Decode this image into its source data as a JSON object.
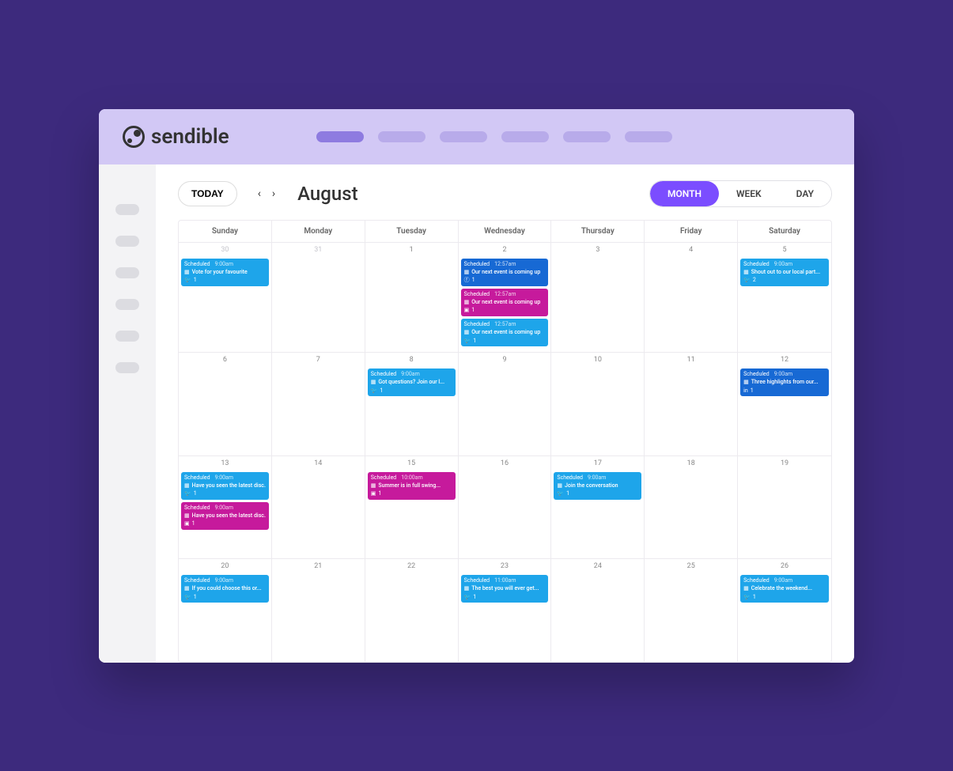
{
  "brand": "sendible",
  "toolbar": {
    "today": "TODAY",
    "month_title": "August",
    "views": {
      "month": "MONTH",
      "week": "WEEK",
      "day": "DAY"
    }
  },
  "dow": [
    "Sunday",
    "Monday",
    "Tuesday",
    "Wednesday",
    "Thursday",
    "Friday",
    "Saturday"
  ],
  "weeks": [
    [
      {
        "num": "30",
        "muted": true,
        "events": [
          {
            "color": "blue",
            "status": "Scheduled",
            "time": "9:00am",
            "title": "Vote for your favourite",
            "service": "twitter",
            "count": "1"
          }
        ]
      },
      {
        "num": "31",
        "muted": true,
        "events": []
      },
      {
        "num": "1",
        "events": []
      },
      {
        "num": "2",
        "events": [
          {
            "color": "dblue",
            "status": "Scheduled",
            "time": "12:57am",
            "title": "Our next event is coming up",
            "service": "facebook",
            "count": "1"
          },
          {
            "color": "pink",
            "status": "Scheduled",
            "time": "12:57am",
            "title": "Our next event is coming up",
            "service": "instagram",
            "count": "1"
          },
          {
            "color": "blue",
            "status": "Scheduled",
            "time": "12:57am",
            "title": "Our next event is coming up",
            "service": "twitter",
            "count": "1"
          }
        ]
      },
      {
        "num": "3",
        "events": []
      },
      {
        "num": "4",
        "events": []
      },
      {
        "num": "5",
        "events": [
          {
            "color": "blue",
            "status": "Scheduled",
            "time": "9:00am",
            "title": "Shout out to our local part...",
            "service": "twitter",
            "count": "2"
          }
        ]
      }
    ],
    [
      {
        "num": "6",
        "events": []
      },
      {
        "num": "7",
        "events": []
      },
      {
        "num": "8",
        "events": [
          {
            "color": "blue",
            "status": "Scheduled",
            "time": "9:00am",
            "title": "Got questions? Join our l...",
            "service": "twitter",
            "count": "1"
          }
        ]
      },
      {
        "num": "9",
        "events": []
      },
      {
        "num": "10",
        "events": []
      },
      {
        "num": "11",
        "events": []
      },
      {
        "num": "12",
        "events": [
          {
            "color": "dblue",
            "status": "Scheduled",
            "time": "9:00am",
            "title": "Three highlights from our...",
            "service": "linkedin",
            "count": "1"
          }
        ]
      }
    ],
    [
      {
        "num": "13",
        "events": [
          {
            "color": "blue",
            "status": "Scheduled",
            "time": "9:00am",
            "title": "Have you seen the latest disc...",
            "service": "twitter",
            "count": "1"
          },
          {
            "color": "pink",
            "status": "Scheduled",
            "time": "9:00am",
            "title": "Have you seen the latest disc...",
            "service": "instagram",
            "count": "1"
          }
        ]
      },
      {
        "num": "14",
        "events": []
      },
      {
        "num": "15",
        "events": [
          {
            "color": "pink",
            "status": "Scheduled",
            "time": "10:00am",
            "title": "Summer is in full swing...",
            "service": "instagram",
            "count": "1"
          }
        ]
      },
      {
        "num": "16",
        "events": []
      },
      {
        "num": "17",
        "events": [
          {
            "color": "blue",
            "status": "Scheduled",
            "time": "9:00am",
            "title": "Join the conversation",
            "service": "twitter",
            "count": "1"
          }
        ]
      },
      {
        "num": "18",
        "events": []
      },
      {
        "num": "19",
        "events": []
      }
    ],
    [
      {
        "num": "20",
        "events": [
          {
            "color": "blue",
            "status": "Scheduled",
            "time": "9:00am",
            "title": "If you could choose this or...",
            "service": "twitter",
            "count": "1"
          }
        ]
      },
      {
        "num": "21",
        "events": []
      },
      {
        "num": "22",
        "events": []
      },
      {
        "num": "23",
        "events": [
          {
            "color": "blue",
            "status": "Scheduled",
            "time": "11:00am",
            "title": "The best you will ever get...",
            "service": "twitter",
            "count": "1"
          }
        ]
      },
      {
        "num": "24",
        "events": []
      },
      {
        "num": "25",
        "events": []
      },
      {
        "num": "26",
        "events": [
          {
            "color": "blue",
            "status": "Scheduled",
            "time": "9:00am",
            "title": "Celebrate the weekend...",
            "service": "twitter",
            "count": "1"
          }
        ]
      }
    ]
  ],
  "colors": {
    "blue": "ev-blue",
    "dblue": "ev-dblue",
    "pink": "ev-pink"
  },
  "service_icons": {
    "twitter": "🐦",
    "facebook": "ⓕ",
    "instagram": "▣",
    "linkedin": "in"
  },
  "gallery_icon": "▦"
}
